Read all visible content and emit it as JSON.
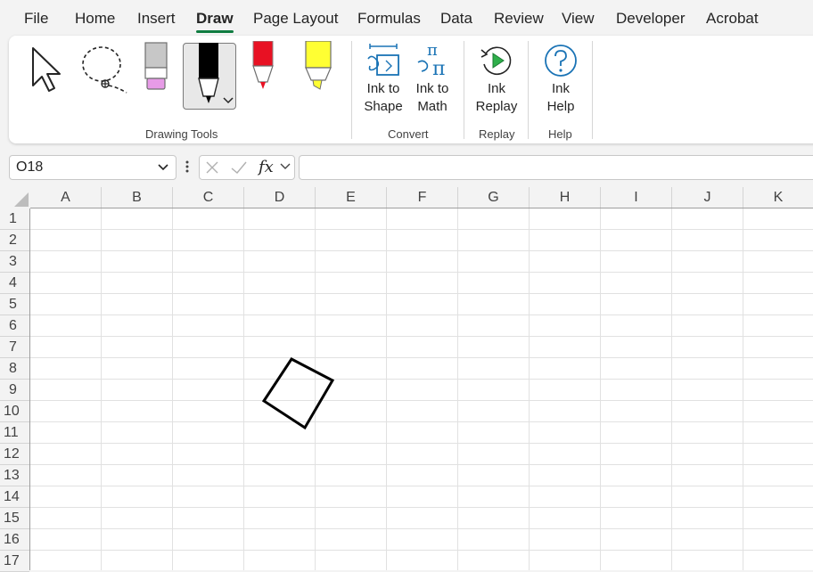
{
  "menu": {
    "tabs": [
      "File",
      "Home",
      "Insert",
      "Draw",
      "Page Layout",
      "Formulas",
      "Data",
      "Review",
      "View",
      "Developer",
      "Acrobat"
    ],
    "active": "Draw"
  },
  "ribbon": {
    "groups": {
      "drawing_tools": "Drawing Tools",
      "convert": "Convert",
      "replay": "Replay",
      "help": "Help"
    },
    "buttons": {
      "ink_to_shape": [
        "Ink to",
        "Shape"
      ],
      "ink_to_math": [
        "Ink to",
        "Math"
      ],
      "ink_replay": [
        "Ink",
        "Replay"
      ],
      "ink_help": [
        "Ink",
        "Help"
      ]
    },
    "icons": [
      "select-arrow-icon",
      "lasso-select-icon",
      "eraser-icon",
      "black-pen-icon",
      "red-pen-icon",
      "yellow-highlighter-icon"
    ],
    "colors": {
      "accent": "#107c41",
      "icon_blue": "#1a73b5",
      "replay_green": "#2eaf4a",
      "pen_black": "#000000",
      "pen_red": "#e81123",
      "highlighter_yellow": "#ffff33",
      "eraser_pink": "#e79be7"
    }
  },
  "formula_bar": {
    "name_box": "O18",
    "fx_label": "fx",
    "formula": ""
  },
  "sheet": {
    "columns": [
      "A",
      "B",
      "C",
      "D",
      "E",
      "F",
      "G",
      "H",
      "I",
      "J",
      "K"
    ],
    "rows": [
      "1",
      "2",
      "3",
      "4",
      "5",
      "6",
      "7",
      "8",
      "9",
      "10",
      "11",
      "12",
      "13",
      "14",
      "15",
      "16",
      "17"
    ],
    "ink_shape": "square"
  }
}
